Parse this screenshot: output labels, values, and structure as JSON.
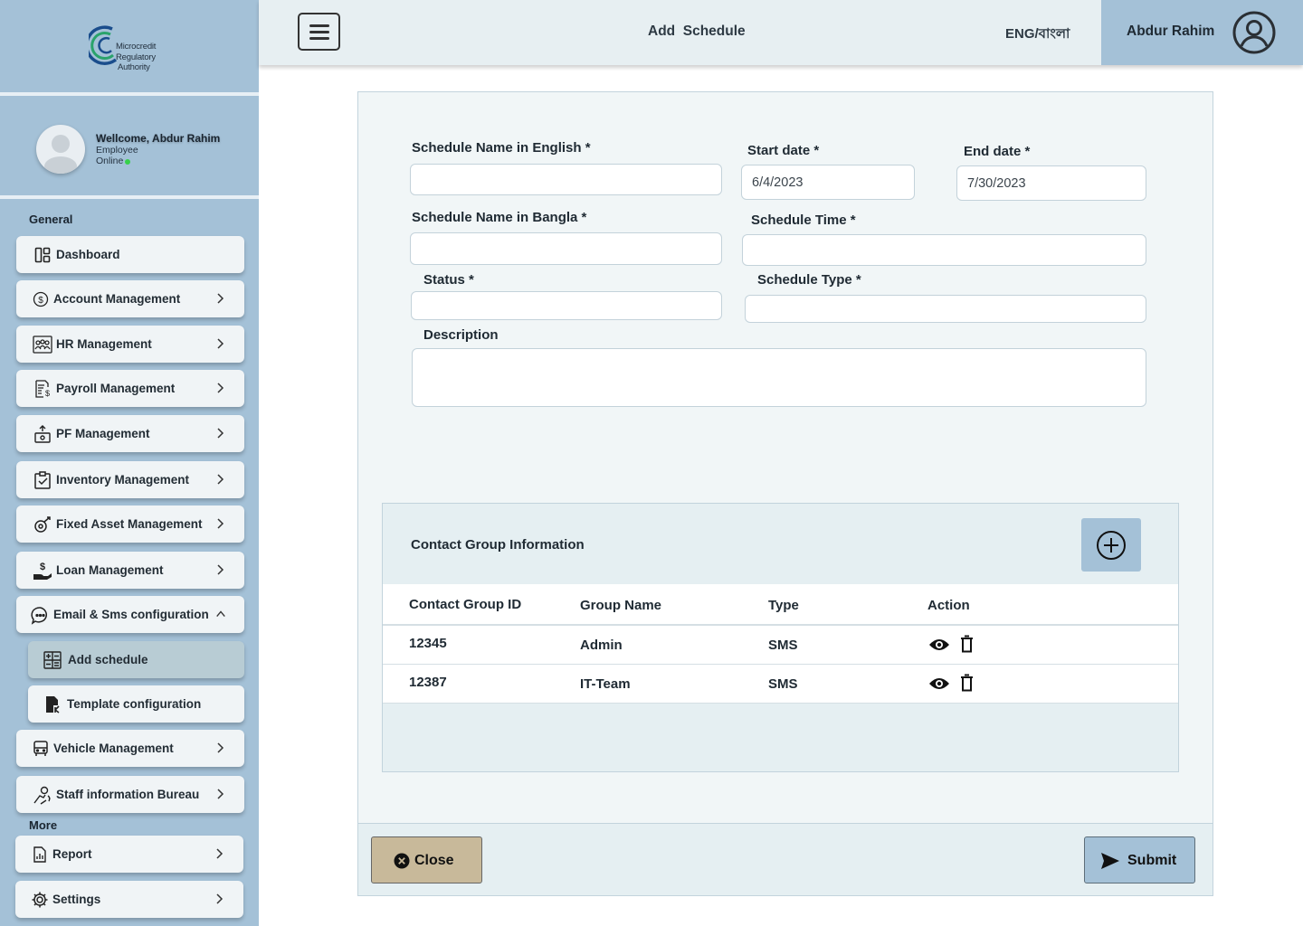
{
  "brand": {
    "logo_lines": [
      "Microcredit",
      "Regulatory",
      "Authority"
    ]
  },
  "profile": {
    "welcome": "Wellcome, Abdur Rahim",
    "role": "Employee",
    "status": "Online"
  },
  "sidebar": {
    "general_label": "General",
    "more_label": "More",
    "items": [
      {
        "label": "Dashboard",
        "icon": "dashboard-icon"
      },
      {
        "label": "Account Management",
        "icon": "dollar-circle-icon"
      },
      {
        "label": "HR Management",
        "icon": "people-icon"
      },
      {
        "label": "Payroll Management",
        "icon": "payroll-icon"
      },
      {
        "label": "PF Management",
        "icon": "pf-icon"
      },
      {
        "label": "Inventory Management",
        "icon": "clipboard-check-icon"
      },
      {
        "label": "Fixed Asset Management",
        "icon": "asset-icon"
      },
      {
        "label": "Loan Management",
        "icon": "loan-hand-icon"
      },
      {
        "label": "Email & Sms configuration",
        "icon": "chat-icon",
        "expanded": true
      },
      {
        "label": "Add schedule",
        "icon": "schedule-icon",
        "active": true
      },
      {
        "label": "Template configuration",
        "icon": "template-file-icon"
      },
      {
        "label": "Vehicle Management",
        "icon": "bus-icon"
      },
      {
        "label": "Staff information Bureau",
        "icon": "staff-icon"
      },
      {
        "label": "Report",
        "icon": "report-icon"
      },
      {
        "label": "Settings",
        "icon": "gear-icon"
      }
    ]
  },
  "topbar": {
    "title": "Add  Schedule",
    "language": "ENG/বাংলা",
    "user_name": "Abdur Rahim"
  },
  "form": {
    "name_en_label": "Schedule Name in English *",
    "name_en_value": "",
    "start_label": "Start date *",
    "start_value": "6/4/2023",
    "end_label": "End date *",
    "end_value": "7/30/2023",
    "name_bn_label": "Schedule Name in Bangla *",
    "name_bn_value": "",
    "time_label": "Schedule Time *",
    "time_value": "",
    "status_label": "Status *",
    "status_value": "",
    "type_label": "Schedule Type *",
    "type_value": "",
    "desc_label": "Description",
    "desc_value": ""
  },
  "contact_group": {
    "title": "Contact Group Information",
    "columns": [
      "Contact Group ID",
      "Group Name",
      "Type",
      "Action"
    ],
    "rows": [
      {
        "id": "12345",
        "name": "Admin",
        "type": "SMS"
      },
      {
        "id": "12387",
        "name": "IT-Team",
        "type": "SMS"
      }
    ]
  },
  "footer": {
    "close_label": "Close",
    "submit_label": "Submit"
  },
  "colors": {
    "sidebar": "#a4c1d7",
    "card": "#f1f6f7",
    "close_button": "#c8b99a",
    "online": "#37d14a"
  }
}
